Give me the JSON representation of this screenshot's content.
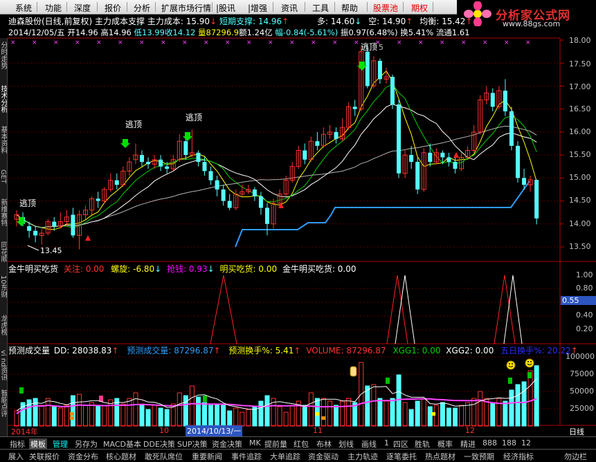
{
  "menu": {
    "items": [
      "系统",
      "功能",
      "深度",
      "报价",
      "分析",
      "扩展市场行情",
      "|股讯",
      "|增强",
      "资讯",
      "工具",
      "帮助",
      "股票池",
      "期权"
    ]
  },
  "logo": {
    "title": "分析家公式网",
    "url": "www.88gs.com"
  },
  "sidebar_tabs": [
    "分时走势",
    "技术分析",
    "基本资料",
    "GET",
    "新维赛特",
    "同花顺",
    "10东财",
    "龙虎榜",
    "vi nd资讯",
    "智能点评",
    "九"
  ],
  "title_row": {
    "stock": "迪森股份(日线,前复权)",
    "indicator": "主力成本支撑",
    "cost": "主力成本: 15.90",
    "support": "短期支撑: 14.96",
    "long": "多: 14.60",
    "short": "空: 14.90",
    "balance": "均衡: 15.42"
  },
  "quote_row": {
    "date": "2014/12/05/五",
    "open": "开14.96",
    "high": "高14.96",
    "low": "低13.99",
    "close": "收14.12",
    "volume": "量87296.9",
    "amount": "额1.24亿",
    "change": "幅-0.84(-5.61%)",
    "amplitude": "振0.97(6.48%)",
    "turnover": "换5.41%",
    "float": "流通1.61"
  },
  "main_price_labels": [
    "18.00",
    "17.50",
    "17.00",
    "16.50",
    "16.00",
    "15.50",
    "15.00",
    "14.50",
    "14.00",
    "13.50"
  ],
  "main_annotations": {
    "escape": "逃顶",
    "low_mark": "13.45",
    "high_mark": "5"
  },
  "ind1": {
    "name": "金牛明买吃货",
    "focus": "关注: 0.00",
    "spiral": "螺旋: -6.80",
    "grab": "抢钱: 0.93",
    "buy": "明买吃货: 0.00",
    "buy2": "金牛明买吃货: 0.00",
    "ticks": [
      "1.00",
      "0.80",
      "0.60",
      "0.40",
      "0.20"
    ],
    "current": "0.55"
  },
  "ind2": {
    "name": "预测成交量",
    "dd": "DD: 28038.83",
    "pred_vol": "预测成交量: 87296.87",
    "pred_turn": "预测换手%: 5.41",
    "volume": "VOLUME: 87296.87",
    "xgg1": "XGG1: 0.00",
    "xgg2": "XGG2: 0.00",
    "five_day": "五日换手%: 20.22",
    "ticks": [
      "100000",
      "75000",
      "50000",
      "25000"
    ]
  },
  "date_axis": {
    "year": "2014年",
    "m10": "10",
    "cursor": "2014/10/13/一",
    "m11": "11",
    "m12": "12",
    "period": "日线"
  },
  "tabs": [
    "指标",
    "模板",
    "管理",
    "另存为",
    "MACD基本",
    "DDE决策",
    "SUP决策",
    "资金决策",
    "MK",
    "提前量",
    "红包",
    "布林",
    "划线",
    "画线",
    "1",
    "四区",
    "胜轨",
    "概率",
    "精进",
    "888",
    "188",
    "12"
  ],
  "bottom_tabs": [
    "展入",
    "关联报价",
    "资金分布",
    "核心题材",
    "敢死队席位",
    "重要新闻",
    "事件追踪",
    "大单追踪",
    "资金驱动",
    "主力轨迹",
    "逐笔委托",
    "热点题材",
    "一致预期",
    "经济指标",
    "勿边栏"
  ],
  "colors": {
    "up": "#ff3232",
    "down": "#54ffff",
    "support": "#2d9cff",
    "ma_white": "#ffffff",
    "ma_yellow": "#ffff00",
    "ma_green": "#00d000"
  }
}
